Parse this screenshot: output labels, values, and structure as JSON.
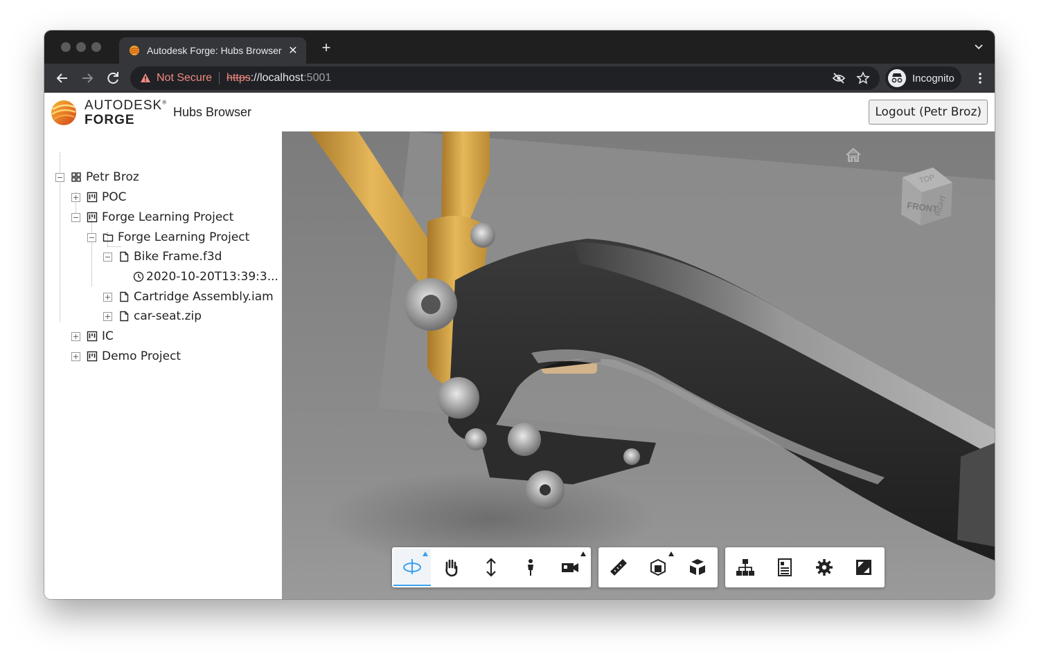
{
  "browser": {
    "tab_title": "Autodesk Forge: Hubs Browser",
    "tab_close": "✕",
    "new_tab": "+",
    "security_label": "Not Secure",
    "url_scheme": "https",
    "url_sep": "://",
    "url_host": "localhost",
    "url_port": ":5001",
    "profile_label": "Incognito",
    "icons": [
      "back-arrow-icon",
      "forward-arrow-icon",
      "reload-icon",
      "warning-icon",
      "eye-slash-icon",
      "star-icon",
      "incognito-icon",
      "kebab-menu-icon",
      "chevron-down-icon"
    ]
  },
  "header": {
    "brand_line1": "AUTODESK",
    "brand_reg": "®",
    "brand_line2": "FORGE",
    "app_title": "Hubs Browser",
    "logout_label": "Logout (Petr Broz)"
  },
  "tree": {
    "nodes": [
      {
        "label": "Petr Broz",
        "kind": "hub",
        "expander": "minus"
      },
      {
        "label": "POC",
        "kind": "project",
        "expander": "plus"
      },
      {
        "label": "Forge Learning Project",
        "kind": "project",
        "expander": "minus"
      },
      {
        "label": "Forge Learning Project",
        "kind": "folder",
        "expander": "minus"
      },
      {
        "label": "Bike Frame.f3d",
        "kind": "item",
        "expander": "minus"
      },
      {
        "label": "2020-10-20T13:39:3...",
        "kind": "version",
        "expander": "none"
      },
      {
        "label": "Cartridge Assembly.iam",
        "kind": "item",
        "expander": "plus"
      },
      {
        "label": "car-seat.zip",
        "kind": "item",
        "expander": "plus"
      },
      {
        "label": "IC",
        "kind": "project",
        "expander": "plus"
      },
      {
        "label": "Demo Project",
        "kind": "project",
        "expander": "plus"
      }
    ]
  },
  "viewer": {
    "viewcube": {
      "top": "TOP",
      "front": "FRONT",
      "right": "RIGHT"
    },
    "toolbar": [
      {
        "group": "navigation",
        "tools": [
          "orbit-tool",
          "pan-tool",
          "zoom-tool",
          "first-person-tool",
          "camera-tool"
        ]
      },
      {
        "group": "modeling",
        "tools": [
          "measure-tool",
          "section-tool",
          "explode-tool"
        ]
      },
      {
        "group": "settings",
        "tools": [
          "model-browser-tool",
          "properties-tool",
          "settings-tool",
          "fullscreen-tool"
        ]
      }
    ],
    "active_tool": "orbit-tool",
    "colors": {
      "frame_gold": "#c99a3a",
      "carbon": "#2b2b2b",
      "background": "#8a8a8a",
      "accent": "#39a0f0"
    }
  }
}
